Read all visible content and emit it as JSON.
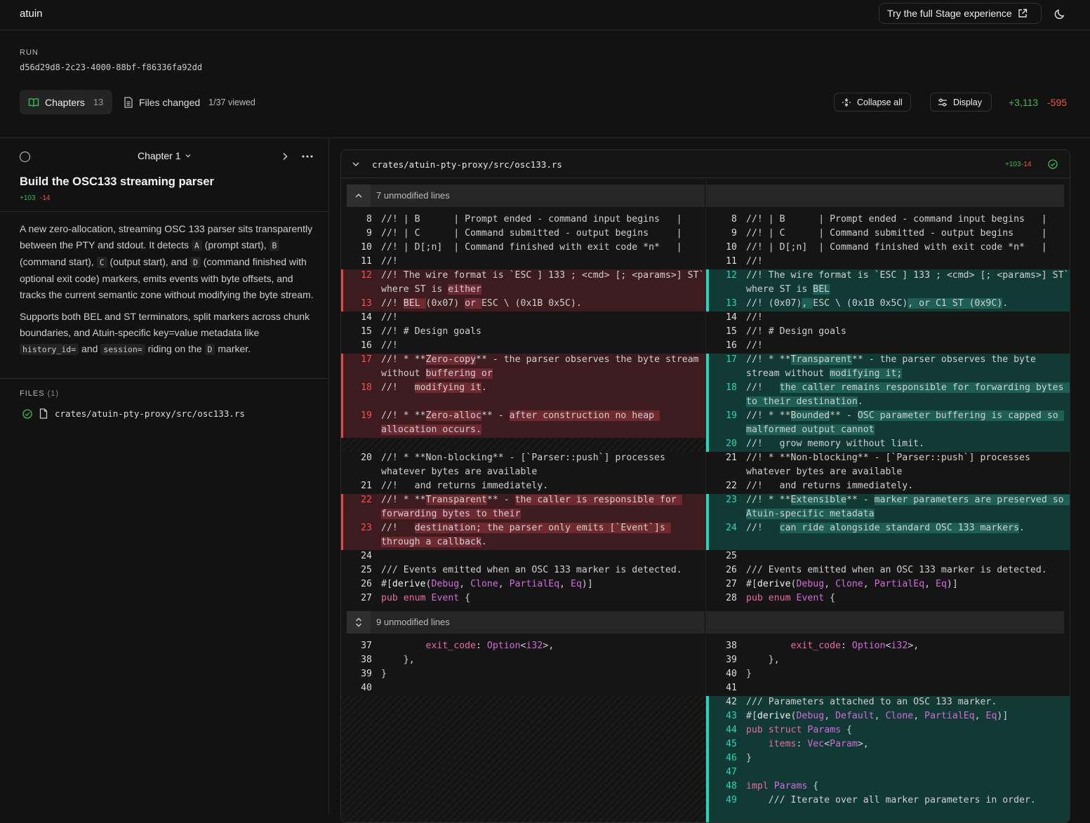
{
  "app": {
    "brand": "atuin",
    "try_label": "Try the full Stage experience"
  },
  "run": {
    "label": "RUN",
    "id": "d56d29d8-2c23-4000-88bf-f86336fa92dd"
  },
  "tabs": {
    "chapters_label": "Chapters",
    "chapters_count": "13",
    "files_label": "Files changed",
    "files_viewed": "1/37 viewed"
  },
  "toolbar": {
    "collapse_label": "Collapse all",
    "display_label": "Display",
    "additions": "+3,113",
    "deletions": "-595"
  },
  "chapter": {
    "selector": "Chapter 1",
    "title": "Build the OSC133 streaming parser",
    "additions": "+103",
    "deletions": "-14",
    "desc1": {
      "t1": "A new zero-allocation, streaming OSC 133 parser sits transparently between the PTY and stdout. It detects ",
      "c1": "A",
      "t2": " (prompt start), ",
      "c2": "B",
      "t3": " (command start), ",
      "c3": "C",
      "t4": " (output start), and ",
      "c4": "D",
      "t5": " (command finished with optional exit code) markers, emits events with byte offsets, and tracks the current semantic zone without modifying the byte stream."
    },
    "desc2": {
      "t1": "Supports both BEL and ST terminators, split markers across chunk boundaries, and Atuin-specific key=value metadata like ",
      "c1": "history_id=",
      "t2": " and ",
      "c2": "session=",
      "t3": " riding on the ",
      "c3": "D",
      "t4": " marker."
    }
  },
  "files": {
    "label": "FILES",
    "count": "(1)",
    "items": [
      {
        "path": "crates/atuin-pty-proxy/src/osc133.rs"
      }
    ]
  },
  "diff": {
    "path": "crates/atuin-pty-proxy/src/osc133.rs",
    "additions": "+103",
    "deletions": "-14",
    "fold1": "7 unmodified lines",
    "fold2": "9 unmodified lines"
  },
  "colors": {
    "add": "#3fb950",
    "del": "#f85149",
    "add_bg": "#123a35",
    "del_bg": "#3c1c1e",
    "accent_teal": "#2bd4bd"
  }
}
